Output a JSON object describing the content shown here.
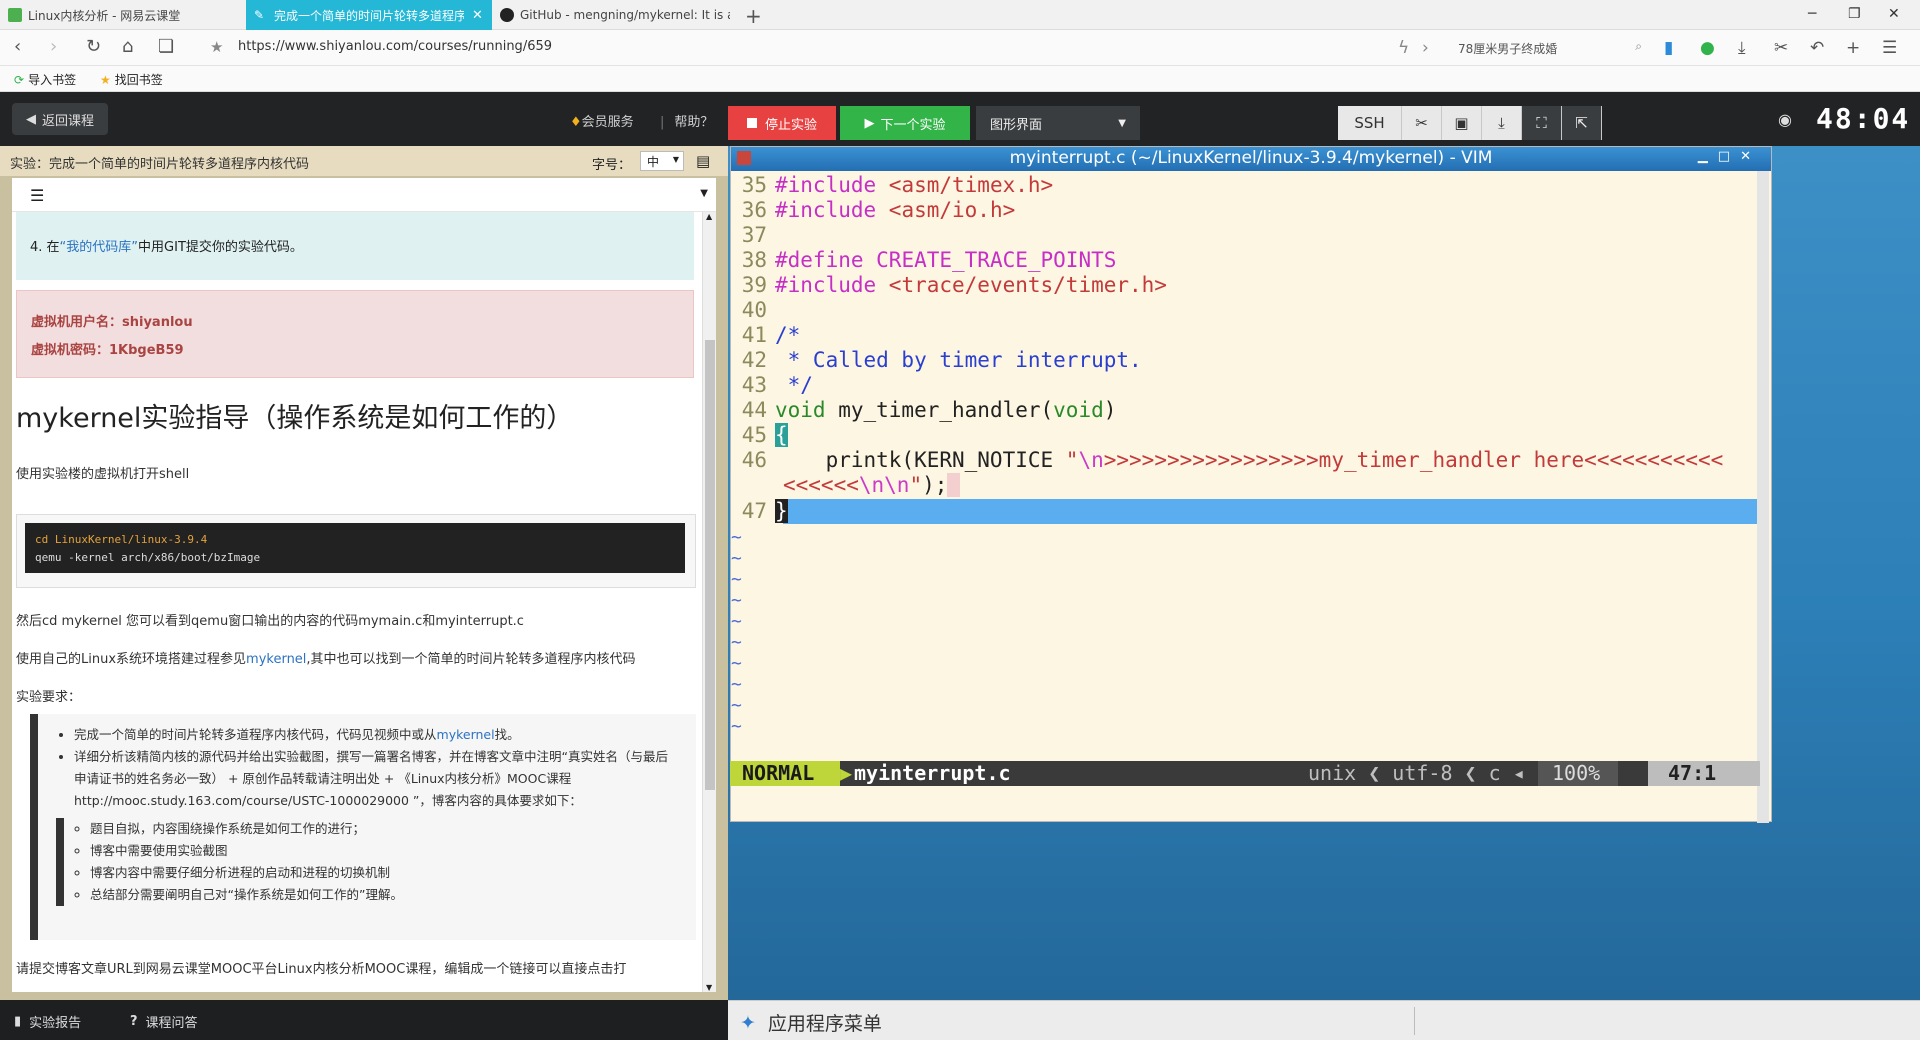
{
  "browser": {
    "tabs": [
      {
        "label": "Linux内核分析 - 网易云课堂",
        "active": false
      },
      {
        "label": "完成一个简单的时间片轮转多道程序",
        "active": true
      },
      {
        "label": "GitHub - mengning/mykernel: It is a",
        "active": false
      }
    ],
    "url": "https://www.shiyanlou.com/courses/running/659",
    "search": "78厘米男子终成婚",
    "bookmarks": [
      "导入书签",
      "找回书签"
    ]
  },
  "lab": {
    "back_label": "返回课程",
    "vip_label": "会员服务",
    "help_label": "帮助？",
    "stop_label": "停止实验",
    "next_label": "下一个实验",
    "mode_label": "图形界面",
    "ssh_label": "SSH",
    "timer": "48:04"
  },
  "course": {
    "title": "实验：完成一个简单的时间片轮转多道程序内核代码",
    "fontsize_label": "字号：",
    "fontsize_value": "中",
    "step4_prefix": "4. 在",
    "step4_link": "“我的代码库”",
    "step4_suffix": "中用GIT提交你的实验代码。",
    "cred_user": "虚拟机用户名：shiyanlou",
    "cred_pass": "虚拟机密码：1KbgeB59",
    "heading": "mykernel实验指导（操作系统是如何工作的）",
    "p1": "使用实验楼的虚拟机打开shell",
    "code_line1_a": "cd LinuxKernel/linux-",
    "code_line1_b": "3.9.4",
    "code_line2": "qemu -kernel arch/x86/boot/bzImage",
    "p2": "然后cd mykernel 您可以看到qemu窗口输出的内容的代码mymain.c和myinterrupt.c",
    "p3_a": "使用自己的Linux系统环境搭建过程参见",
    "p3_link": "mykernel",
    "p3_b": ",其中也可以找到一个简单的时间片轮转多道程序内核代码",
    "p4": "实验要求：",
    "req1_a": "完成一个简单的时间片轮转多道程序内核代码，代码见视频中或从",
    "req1_link": "mykernel",
    "req1_b": "找。",
    "req2": "详细分析该精简内核的源代码并给出实验截图，撰写一篇署名博客，并在博客文章中注明“真实姓名（与最后申请证书的姓名务必一致） + 原创作品转载请注明出处 + 《Linux内核分析》MOOC课程http://mooc.study.163.com/course/USTC-1000029000 ”，博客内容的具体要求如下：",
    "sub1": "题目自拟，内容围绕操作系统是如何工作的进行；",
    "sub2": "博客中需要使用实验截图",
    "sub3": "博客内容中需要仔细分析进程的启动和进程的切换机制",
    "sub4": "总结部分需要阐明自己对“操作系统是如何工作的”理解。",
    "p5": "请提交博客文章URL到网易云课堂MOOC平台Linux内核分析MOOC课程，编辑成一个链接可以直接点击打",
    "footer_report": "实验报告",
    "footer_qa": "课程问答"
  },
  "vim": {
    "title": "myinterrupt.c (~/LinuxKernel/linux-3.9.4/mykernel) - VIM",
    "lines": {
      "n35": "35",
      "n36": "36",
      "n37": "37",
      "n38": "38",
      "n39": "39",
      "n40": "40",
      "n41": "41",
      "n42": "42",
      "n43": "43",
      "n44": "44",
      "n45": "45",
      "n46": "46",
      "n47": "47",
      "l35_pp": "#include",
      "l35_inc": " <asm/timex.h>",
      "l36_pp": "#include",
      "l36_inc": " <asm/io.h>",
      "l38_pp": "#define",
      "l38_inc": " CREATE_TRACE_POINTS",
      "l39_pp": "#include",
      "l39_inc": " <trace/events/timer.h>",
      "l41": "/*",
      "l42": " * Called by timer interrupt.",
      "l43": " */",
      "l44_t1": "void",
      "l44_mid": " my_timer_handler(",
      "l44_t2": "void",
      "l44_end": ")",
      "l45": "{",
      "l46_a": "    printk(KERN_NOTICE ",
      "l46_q": "\"",
      "l46_esc": "\\n",
      "l46_str": ">>>>>>>>>>>>>>>>>my_timer_handler here<<<<<<<<<<<",
      "l46w_str": "<<<<<<",
      "l46w_esc1": "\\n",
      "l46w_esc2": "\\n",
      "l46w_end_q": "\"",
      "l46w_end": ");",
      "l47": "}"
    },
    "mode": "NORMAL",
    "filename": "myinterrupt.c",
    "meta": "unix ❮ utf-8 ❮ c ◂",
    "percent": "100%",
    "position": "47:1"
  },
  "desktop": {
    "app_menu": "应用程序菜单"
  },
  "colors": {
    "accent_tab": "#24b7d6",
    "stop": "#e84141",
    "next": "#33b449",
    "vim_bg": "#fdf6e3",
    "cursorline": "#5aaef0"
  }
}
